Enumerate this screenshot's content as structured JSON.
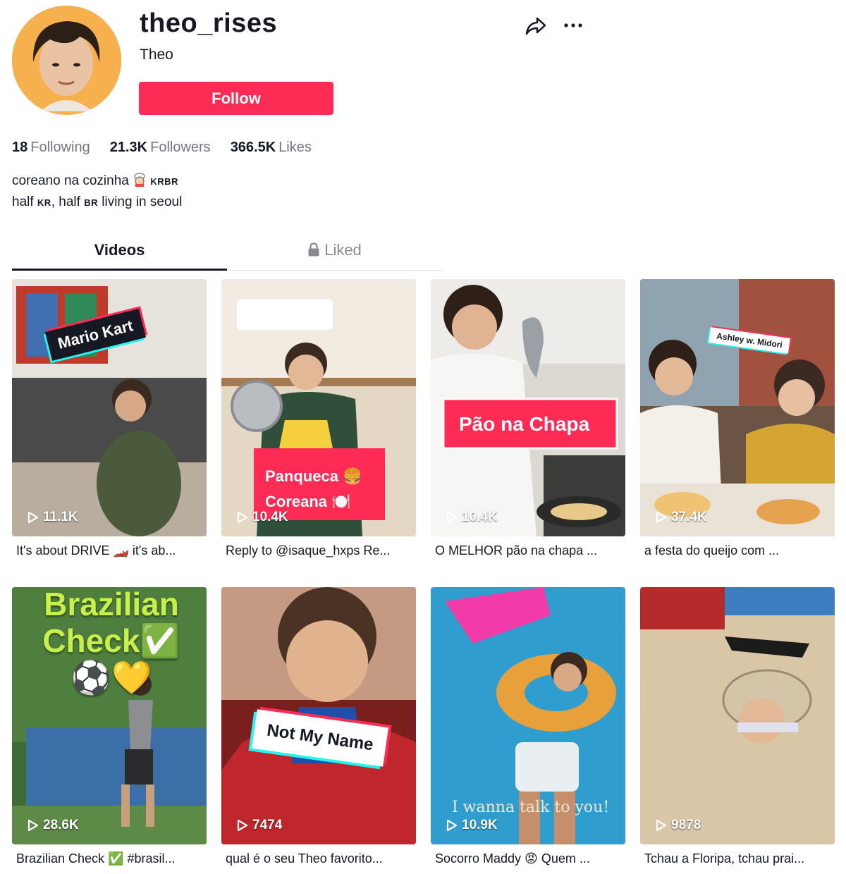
{
  "profile": {
    "username": "theo_rises",
    "nickname": "Theo",
    "follow_label": "Follow",
    "avatar_icon": "profile-avatar"
  },
  "stats": [
    {
      "value": "18",
      "label": "Following"
    },
    {
      "value": "21.3K",
      "label": "Followers"
    },
    {
      "value": "366.5K",
      "label": "Likes"
    }
  ],
  "bio": {
    "line1_text": "coreano na cozinha",
    "line1_tag": "KRBR",
    "line2_a": "half",
    "line2_kr": "KR",
    "line2_b": ", half",
    "line2_br": "BR",
    "line2_c": " living in seoul"
  },
  "tabs": [
    {
      "label": "Videos",
      "active": true
    },
    {
      "label": "Liked",
      "active": false,
      "icon": "lock-icon"
    }
  ],
  "videos": [
    {
      "views": "11.1K",
      "caption": "It's about DRIVE 🏎️ it's ab...",
      "overlay": "Mario Kart"
    },
    {
      "views": "10.4K",
      "caption": "Reply to @isaque_hxps Re...",
      "overlay": "Panqueca 🍔 Coreana 🍽️"
    },
    {
      "views": "10.4K",
      "caption": "O MELHOR pão na chapa ...",
      "overlay": "Pão na Chapa"
    },
    {
      "views": "37.4K",
      "caption": "a festa do queijo com ...",
      "overlay": "Ashley w. Midori"
    },
    {
      "views": "28.6K",
      "caption": "Brazilian Check ✅ #brasil...",
      "overlay": "Brazilian Check✅⚽💛"
    },
    {
      "views": "7474",
      "caption": "qual é o seu Theo favorito...",
      "overlay": "Not My Name"
    },
    {
      "views": "10.9K",
      "caption": "Socorro Maddy 😡 Quem ...",
      "overlay": "I wanna talk to you!"
    },
    {
      "views": "9878",
      "caption": "Tchau a Floripa, tchau prai...",
      "overlay": ""
    }
  ],
  "colors": {
    "accent": "#fe2c55",
    "text": "#161823",
    "muted": "#75767e"
  }
}
